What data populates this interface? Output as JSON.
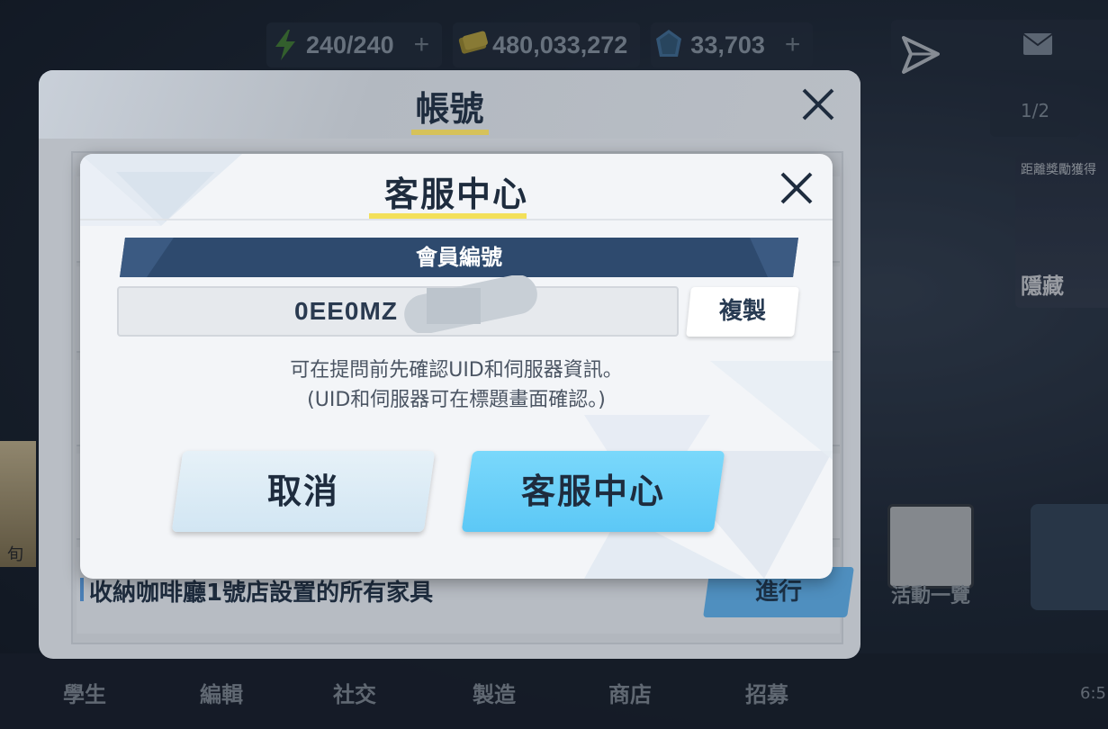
{
  "top_bar": {
    "stamina": "240/240",
    "credits": "480,033,272",
    "gems": "33,703"
  },
  "right_panel": {
    "page_indicator": "1/2",
    "event_banner_small": "距離獎勵獲得",
    "event_banner_big": "隱藏",
    "calendar_label": "活動一覽"
  },
  "left_char_label": "旬",
  "bottom_nav": {
    "items": [
      "學生",
      "編輯",
      "社交",
      "製造",
      "商店",
      "招募"
    ],
    "time": "6:5"
  },
  "account_panel": {
    "title": "帳號",
    "last_row_label": "收納咖啡廳1號店設置的所有家具",
    "last_row_button": "進行"
  },
  "dialog": {
    "title": "客服中心",
    "member_label": "會員編號",
    "member_id_visible": "0EE0MZ",
    "copy_label": "複製",
    "info_line1": "可在提問前先確認UID和伺服器資訊。",
    "info_line2": "(UID和伺服器可在標題畫面確認。)",
    "cancel_label": "取消",
    "service_label": "客服中心"
  }
}
